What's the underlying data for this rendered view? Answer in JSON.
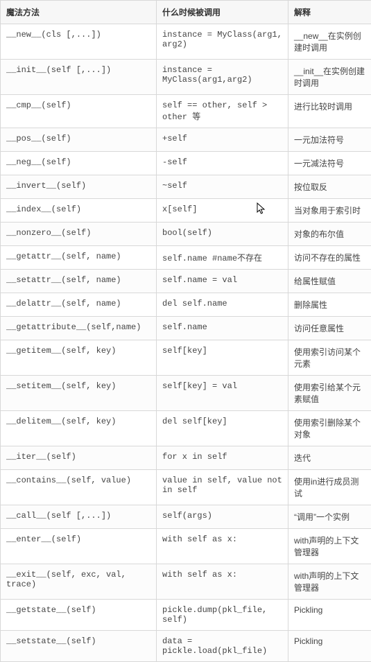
{
  "headers": {
    "method": "魔法方法",
    "when": "什么时候被调用",
    "explain": "解释"
  },
  "rows": [
    {
      "method": "__new__(cls [,...])",
      "when": "instance = MyClass(arg1, arg2)",
      "explain": "__new__在实例创建时调用"
    },
    {
      "method": "__init__(self [,...])",
      "when": "instance = MyClass(arg1,arg2)",
      "explain": "__init__在实例创建时调用"
    },
    {
      "method": "__cmp__(self)",
      "when": "self == other, self > other 等",
      "explain": "进行比较时调用"
    },
    {
      "method": "__pos__(self)",
      "when": "+self",
      "explain": "一元加法符号"
    },
    {
      "method": "__neg__(self)",
      "when": "-self",
      "explain": "一元减法符号"
    },
    {
      "method": "__invert__(self)",
      "when": "~self",
      "explain": "按位取反"
    },
    {
      "method": "__index__(self)",
      "when": "x[self]",
      "explain": "当对象用于索引时"
    },
    {
      "method": "__nonzero__(self)",
      "when": "bool(self)",
      "explain": "对象的布尔值"
    },
    {
      "method": "__getattr__(self, name)",
      "when": "self.name #name不存在",
      "explain": "访问不存在的属性"
    },
    {
      "method": "__setattr__(self, name)",
      "when": "self.name = val",
      "explain": "给属性赋值"
    },
    {
      "method": "__delattr__(self, name)",
      "when": "del self.name",
      "explain": "删除属性"
    },
    {
      "method": "__getattribute__(self,name)",
      "when": "self.name",
      "explain": "访问任意属性"
    },
    {
      "method": "__getitem__(self, key)",
      "when": "self[key]",
      "explain": "使用索引访问某个元素"
    },
    {
      "method": "__setitem__(self, key)",
      "when": "self[key] = val",
      "explain": "使用索引给某个元素赋值"
    },
    {
      "method": "__delitem__(self, key)",
      "when": "del self[key]",
      "explain": "使用索引删除某个对象"
    },
    {
      "method": "__iter__(self)",
      "when": "for x in self",
      "explain": "迭代"
    },
    {
      "method": "__contains__(self, value)",
      "when": "value in self, value not in self",
      "explain": "使用in进行成员测试"
    },
    {
      "method": "__call__(self [,...])",
      "when": "self(args)",
      "explain": "“调用”一个实例"
    },
    {
      "method": "__enter__(self)",
      "when": "with self as x:",
      "explain": "with声明的上下文管理器"
    },
    {
      "method": "__exit__(self, exc, val, trace)",
      "when": "with self as x:",
      "explain": "with声明的上下文管理器"
    },
    {
      "method": "__getstate__(self)",
      "when": "pickle.dump(pkl_file, self)",
      "explain": "Pickling"
    },
    {
      "method": "__setstate__(self)",
      "when": "data = pickle.load(pkl_file)",
      "explain": "Pickling"
    }
  ]
}
